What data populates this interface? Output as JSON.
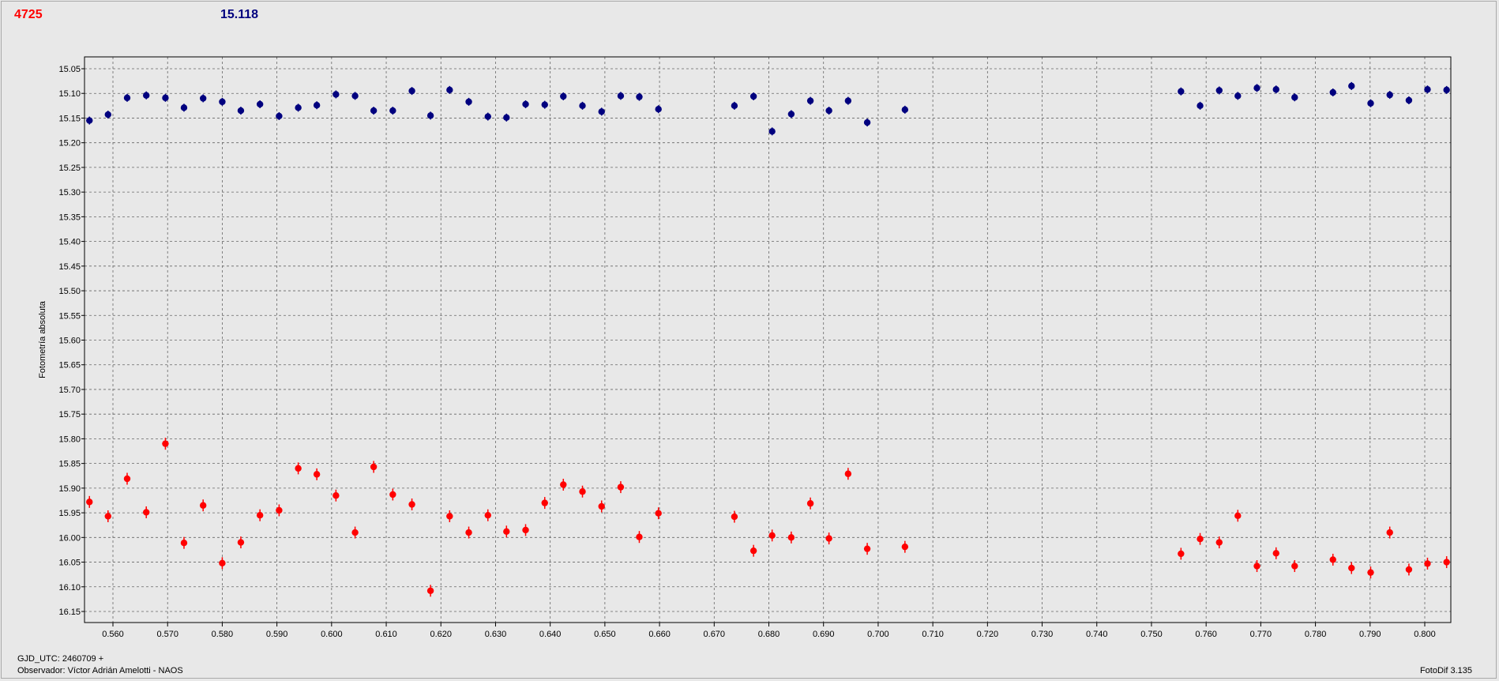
{
  "header": {
    "comparison_label": "4725",
    "magnitude_label": "15.118"
  },
  "footer": {
    "gjd": "GJD_UTC: 2460709 +",
    "observer": "Observador: Víctor Adrián Amelotti - NAOS",
    "software": "FotoDif 3.135"
  },
  "colors": {
    "series_red": "#ff0000",
    "series_blue": "#00007f",
    "background": "#e8e8e8",
    "grid": "#666666"
  },
  "chart_data": {
    "type": "scatter",
    "title": "",
    "ylabel": "Fotometría absoluta",
    "xlabel": "",
    "xlim": [
      0.5555,
      0.8045
    ],
    "ylim": [
      15.165,
      15.025
    ],
    "y_inverted": true,
    "grid": true,
    "x_ticks": [
      "0.560",
      "0.570",
      "0.580",
      "0.590",
      "0.600",
      "0.610",
      "0.620",
      "0.630",
      "0.640",
      "0.650",
      "0.660",
      "0.670",
      "0.680",
      "0.690",
      "0.700",
      "0.710",
      "0.720",
      "0.730",
      "0.740",
      "0.750",
      "0.760",
      "0.770",
      "0.780",
      "0.790",
      "0.800"
    ],
    "y_ticks": [
      "15.05",
      "15.10",
      "15.15",
      "15.20",
      "15.25",
      "15.30",
      "15.35",
      "15.40",
      "15.45",
      "15.50",
      "15.55",
      "15.60",
      "15.65",
      "15.70",
      "15.75",
      "15.80",
      "15.85",
      "15.90",
      "15.95",
      "16.00",
      "16.05",
      "16.10",
      "16.15"
    ],
    "series": [
      {
        "color": "#00007f",
        "error": 0.008,
        "x": [
          0.5557,
          0.5591,
          0.5626,
          0.5661,
          0.5696,
          0.573,
          0.5765,
          0.58,
          0.5834,
          0.5869,
          0.5904,
          0.5939,
          0.5973,
          0.6008,
          0.6043,
          0.6077,
          0.6112,
          0.6147,
          0.6181,
          0.6216,
          0.6251,
          0.6286,
          0.632,
          0.6355,
          0.639,
          0.6424,
          0.6459,
          0.6494,
          0.6529,
          0.6563,
          0.6598,
          0.6737,
          0.6772,
          0.6806,
          0.6841,
          0.6876,
          0.691,
          0.6945,
          0.698,
          0.7049,
          0.7554,
          0.7589,
          0.7624,
          0.7658,
          0.7693,
          0.7728,
          0.7762,
          0.7832,
          0.7866,
          0.7901,
          0.7936,
          0.7971,
          0.8005,
          0.804
        ],
        "y": [
          15.155,
          15.143,
          15.109,
          15.104,
          15.109,
          15.129,
          15.11,
          15.117,
          15.135,
          15.122,
          15.146,
          15.129,
          15.124,
          15.102,
          15.105,
          15.135,
          15.135,
          15.095,
          15.145,
          15.093,
          15.117,
          15.147,
          15.149,
          15.122,
          15.123,
          15.106,
          15.125,
          15.137,
          15.105,
          15.107,
          15.132,
          15.125,
          15.106,
          15.177,
          15.142,
          15.115,
          15.135,
          15.115,
          15.159,
          15.133,
          15.096,
          15.125,
          15.094,
          15.105,
          15.089,
          15.092,
          15.108,
          15.098,
          15.085,
          15.12,
          15.103,
          15.114,
          15.092,
          15.093
        ]
      },
      {
        "color": "#ff0000",
        "error": 0.012,
        "x": [
          0.5557,
          0.5591,
          0.5626,
          0.5661,
          0.5696,
          0.573,
          0.5765,
          0.58,
          0.5834,
          0.5869,
          0.5904,
          0.5939,
          0.5973,
          0.6008,
          0.6043,
          0.6077,
          0.6112,
          0.6147,
          0.6181,
          0.6216,
          0.6251,
          0.6286,
          0.632,
          0.6355,
          0.639,
          0.6424,
          0.6459,
          0.6494,
          0.6529,
          0.6563,
          0.6598,
          0.6737,
          0.6772,
          0.6806,
          0.6841,
          0.6876,
          0.691,
          0.6945,
          0.698,
          0.7049,
          0.7554,
          0.7589,
          0.7624,
          0.7658,
          0.7693,
          0.7728,
          0.7762,
          0.7832,
          0.7866,
          0.7901,
          0.7936,
          0.7971,
          0.8005,
          0.804
        ],
        "y": [
          15.928,
          15.957,
          15.881,
          15.949,
          15.81,
          16.011,
          15.935,
          16.052,
          16.01,
          15.955,
          15.945,
          15.86,
          15.872,
          15.915,
          15.99,
          15.857,
          15.913,
          15.933,
          16.108,
          15.957,
          15.99,
          15.955,
          15.988,
          15.985,
          15.93,
          15.893,
          15.907,
          15.937,
          15.898,
          15.999,
          15.951,
          15.958,
          16.027,
          15.996,
          16.0,
          15.931,
          16.002,
          15.871,
          16.023,
          16.019,
          16.033,
          16.003,
          16.01,
          15.956,
          16.058,
          16.032,
          16.058,
          16.045,
          16.062,
          16.071,
          15.99,
          16.065,
          16.053,
          16.05
        ]
      }
    ]
  }
}
